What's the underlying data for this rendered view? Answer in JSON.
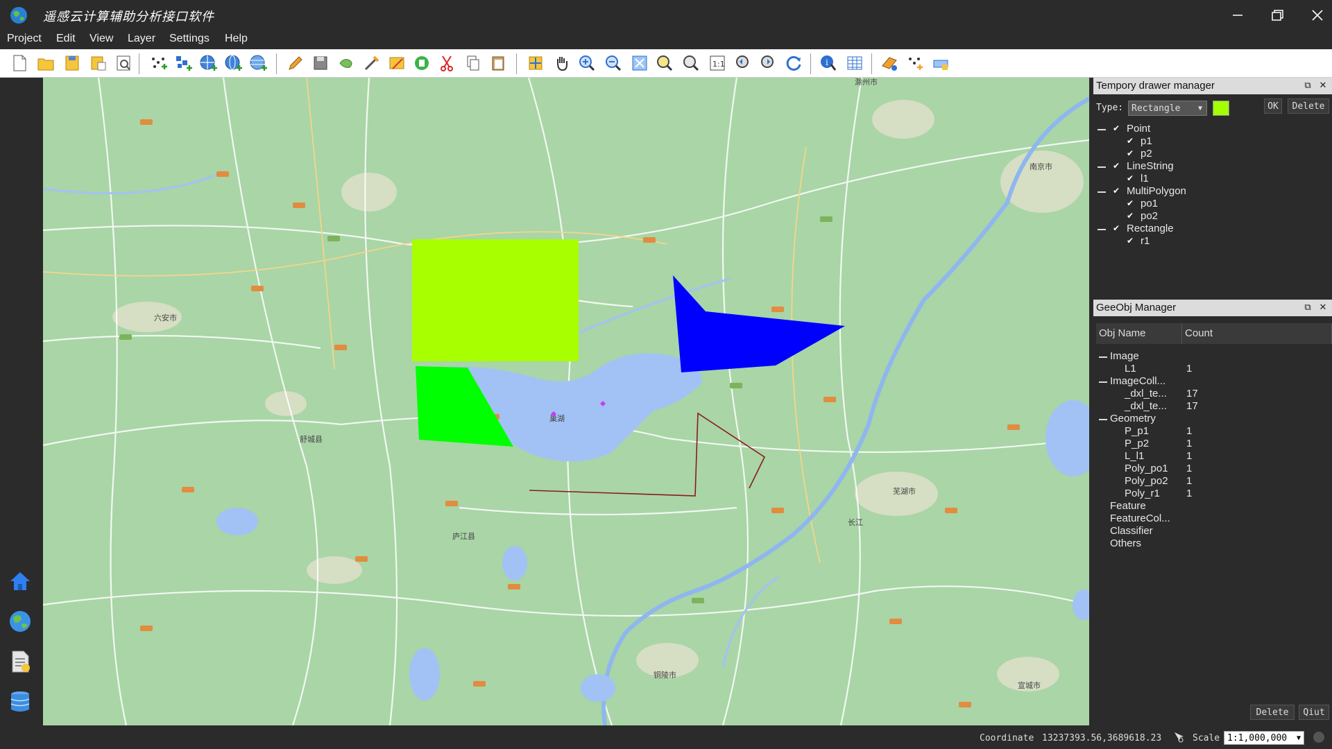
{
  "app": {
    "title": "遥感云计算辅助分析接口软件"
  },
  "menu": [
    "Project",
    "Edit",
    "View",
    "Layer",
    "Settings",
    "Help"
  ],
  "map": {
    "labels": {
      "luan": "六安市",
      "nanjing": "南京市",
      "wuhu": "芜湖市",
      "tongling": "铜陵市",
      "xuancheng": "宣城市",
      "chuzhou": "滁州市",
      "chaohu": "巢湖",
      "changjiang": "长江",
      "lujiang": "庐江县",
      "shucheng": "舒城县"
    },
    "colors": {
      "rect": "#a8ff00",
      "poly_green": "#00ff00",
      "poly_blue": "#0000ff",
      "line": "#8b1a1a",
      "lake": "#a2c2f5",
      "land": "#a9d5a7"
    }
  },
  "drawer": {
    "title": "Tempory drawer manager",
    "type_label": "Type:",
    "type_value": "Rectangle",
    "color": "#a4ff00",
    "ok": "OK",
    "delete": "Delete",
    "groups": [
      {
        "name": "Point",
        "items": [
          "p1",
          "p2"
        ]
      },
      {
        "name": "LineString",
        "items": [
          "l1"
        ]
      },
      {
        "name": "MultiPolygon",
        "items": [
          "po1",
          "po2"
        ]
      },
      {
        "name": "Rectangle",
        "items": [
          "r1"
        ]
      }
    ]
  },
  "geeobj": {
    "title": "GeeObj Manager",
    "col_name": "Obj Name",
    "col_count": "Count",
    "rows": [
      {
        "level": 0,
        "name": "Image",
        "count": "",
        "group": true
      },
      {
        "level": 1,
        "name": "L1",
        "count": "1"
      },
      {
        "level": 0,
        "name": "ImageColl...",
        "count": "",
        "group": true
      },
      {
        "level": 1,
        "name": "_dxl_te...",
        "count": "17"
      },
      {
        "level": 1,
        "name": "_dxl_te...",
        "count": "17"
      },
      {
        "level": 0,
        "name": "Geometry",
        "count": "",
        "group": true
      },
      {
        "level": 1,
        "name": "P_p1",
        "count": "1"
      },
      {
        "level": 1,
        "name": "P_p2",
        "count": "1"
      },
      {
        "level": 1,
        "name": "L_l1",
        "count": "1"
      },
      {
        "level": 1,
        "name": "Poly_po1",
        "count": "1"
      },
      {
        "level": 1,
        "name": "Poly_po2",
        "count": "1"
      },
      {
        "level": 1,
        "name": "Poly_r1",
        "count": "1"
      },
      {
        "level": 0,
        "name": "Feature",
        "count": ""
      },
      {
        "level": 0,
        "name": "FeatureCol...",
        "count": ""
      },
      {
        "level": 0,
        "name": "Classifier",
        "count": ""
      },
      {
        "level": 0,
        "name": "Others",
        "count": ""
      }
    ],
    "delete": "Delete",
    "quit": "Qiut"
  },
  "status": {
    "coord_label": "Coordinate",
    "coord_value": "13237393.56,3689618.23",
    "scale_label": "Scale",
    "scale_value": "1:1,000,000"
  }
}
